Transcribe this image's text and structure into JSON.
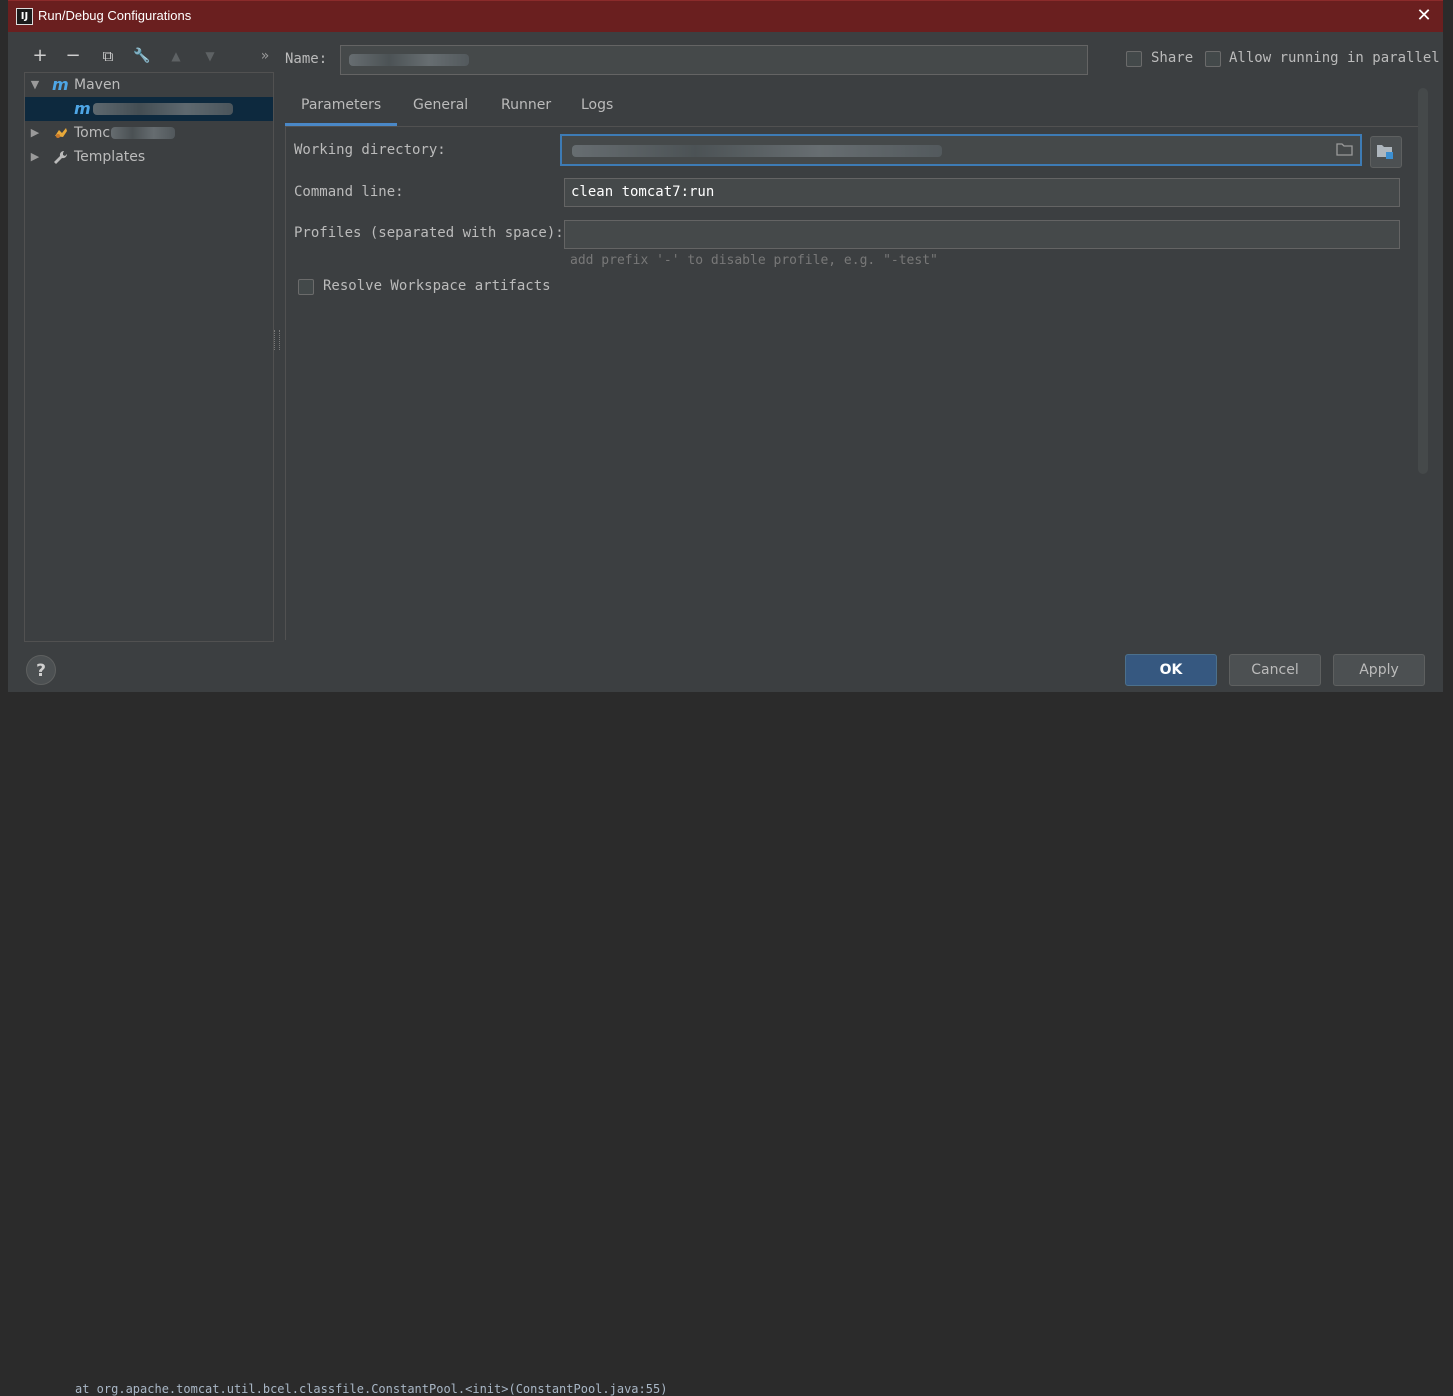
{
  "window": {
    "title": "Run/Debug Configurations",
    "icon_text": "IJ",
    "close_glyph": "✕"
  },
  "toolbar": {
    "add": "+",
    "remove": "−",
    "copy": "⧉",
    "edit": "🔧",
    "move_up": "▲",
    "move_down": "▼",
    "more": "»"
  },
  "tree": {
    "maven_label": "Maven",
    "maven_icon": "m",
    "tomcat_label": "Tomc",
    "templates_label": "Templates",
    "expanded_arrow": "▼",
    "collapsed_arrow": "▶"
  },
  "name_row": {
    "label": "Name:"
  },
  "options": {
    "share": "Share",
    "parallel": "Allow running in parallel"
  },
  "tabs": [
    "Parameters",
    "General",
    "Runner",
    "Logs"
  ],
  "form": {
    "working_dir_label": "Working directory:",
    "command_label": "Command line:",
    "command_value": "clean tomcat7:run",
    "profiles_label": "Profiles (separated with space):",
    "profiles_hint": "add prefix '-' to disable profile, e.g. \"-test\"",
    "resolve_label": "Resolve Workspace artifacts"
  },
  "buttons": {
    "help": "?",
    "ok": "OK",
    "cancel": "Cancel",
    "apply": "Apply"
  },
  "background": {
    "console_line": "at org.apache.tomcat.util.bcel.classfile.ConstantPool.<init>(ConstantPool.java:55)"
  },
  "colors": {
    "title_bar": "#6a1f1f",
    "accent": "#4a88c7",
    "ok_button": "#365880",
    "maven_icon": "#4ea6e6"
  }
}
